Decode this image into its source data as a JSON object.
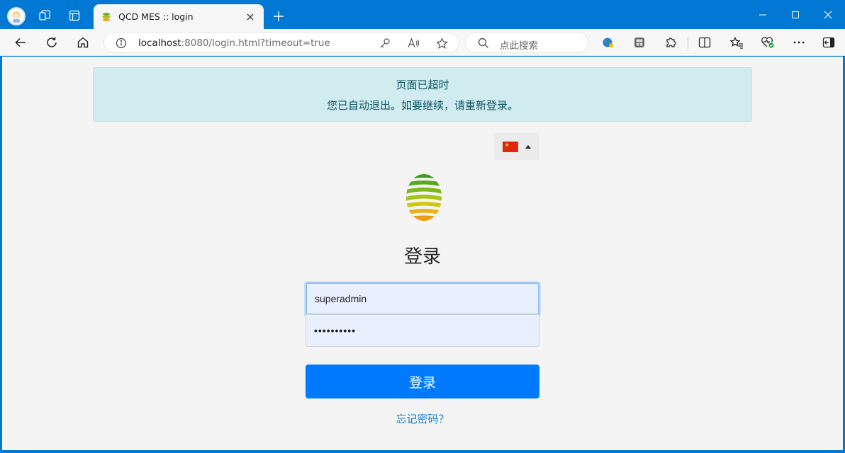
{
  "browser": {
    "tab_title": "QCD MES :: login",
    "url_host": "localhost",
    "url_rest": ":8080/login.html?timeout=true",
    "search_placeholder": "点此搜索",
    "accent": "#0078d4"
  },
  "page": {
    "alert_title": "页面已超时",
    "alert_message": "您已自动退出。如要继续，请重新登录。",
    "language_flag": "cn-flag-icon",
    "heading": "登录",
    "username_value": "superadmin",
    "password_masked": "••••••••••",
    "submit_label": "登录",
    "forgot_link": "忘记密码？",
    "primary_color": "#007bff",
    "alert_color": "#d1ecf1"
  }
}
